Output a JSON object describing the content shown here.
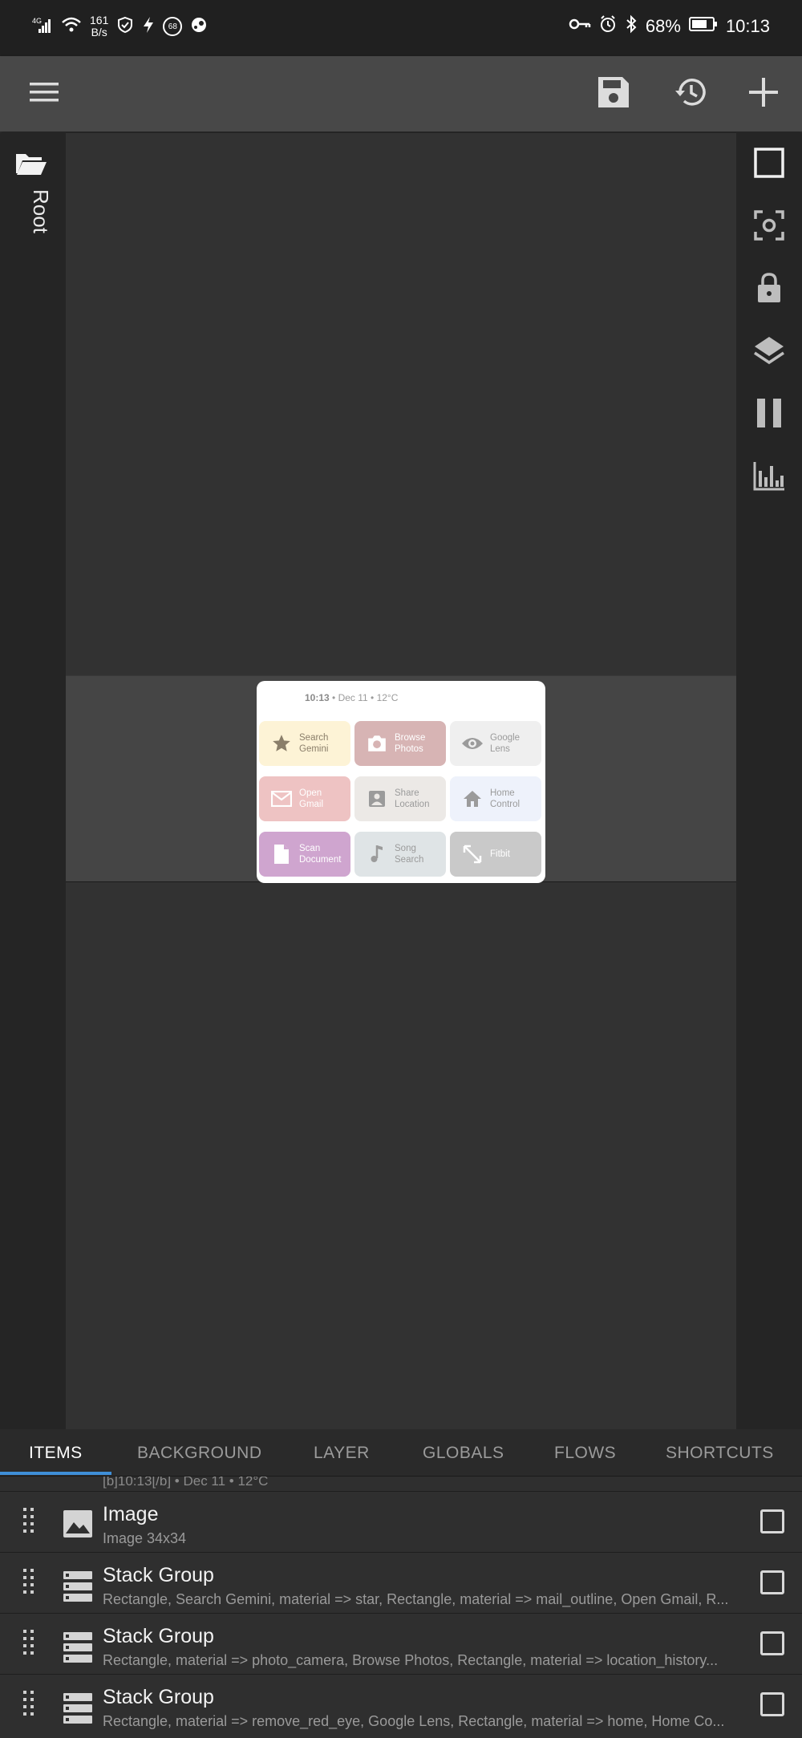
{
  "status_bar": {
    "network": "4G",
    "speed_value": "161",
    "speed_unit": "B/s",
    "notif_badge": "68",
    "battery": "68%",
    "time": "10:13"
  },
  "toolbar": {
    "menu_icon": "menu-icon",
    "save_icon": "save-icon",
    "history_icon": "history-icon",
    "add_icon": "add-icon"
  },
  "left_panel": {
    "root_label": "Root"
  },
  "right_panel": {
    "icons": [
      "square-outline-icon",
      "focus-camera-icon",
      "lock-icon",
      "layers-icon",
      "pause-icon",
      "bar-chart-icon"
    ]
  },
  "widget": {
    "time": "10:13",
    "date_weather": " • Dec 11 • 12°C",
    "tiles": [
      {
        "label1": "Search",
        "label2": "Gemini",
        "icon": "star-icon",
        "bg": "#fdf3d6",
        "fg": "#8a7e6a"
      },
      {
        "label1": "Browse",
        "label2": "Photos",
        "icon": "camera-icon",
        "bg": "#d7b4b4",
        "fg": "#ffffff"
      },
      {
        "label1": "Google",
        "label2": "Lens",
        "icon": "eye-icon",
        "bg": "#efefef",
        "fg": "#9b9b9b"
      },
      {
        "label1": "Open",
        "label2": "Gmail",
        "icon": "mail-icon",
        "bg": "#eec3c3",
        "fg": "#ffffff"
      },
      {
        "label1": "Share",
        "label2": "Location",
        "icon": "location-icon",
        "bg": "#ece9e6",
        "fg": "#9b9b9b"
      },
      {
        "label1": "Home",
        "label2": "Control",
        "icon": "home-icon",
        "bg": "#eef2fb",
        "fg": "#9b9b9b"
      },
      {
        "label1": "Scan",
        "label2": "Document",
        "icon": "document-icon",
        "bg": "#cfa5cf",
        "fg": "#ffffff"
      },
      {
        "label1": "Song",
        "label2": "Search",
        "icon": "music-icon",
        "bg": "#dfe4e6",
        "fg": "#9b9b9b"
      },
      {
        "label1": "Fitbit",
        "label2": "",
        "icon": "expand-icon",
        "bg": "#c9c9c9",
        "fg": "#ffffff"
      }
    ]
  },
  "tabs": [
    "ITEMS",
    "BACKGROUND",
    "LAYER",
    "GLOBALS",
    "FLOWS",
    "SHORTCUTS"
  ],
  "list": {
    "partial_text": "[b]10:13[/b] • Dec 11 • 12°C",
    "rows": [
      {
        "title": "Image",
        "subtitle": "Image 34x34",
        "icon": "image-icon"
      },
      {
        "title": "Stack Group",
        "subtitle": "Rectangle, Search Gemini, material => star, Rectangle, material => mail_outline, Open Gmail, R...",
        "icon": "stack-group-icon"
      },
      {
        "title": "Stack Group",
        "subtitle": "Rectangle, material => photo_camera, Browse Photos, Rectangle, material => location_history...",
        "icon": "stack-group-icon"
      },
      {
        "title": "Stack Group",
        "subtitle": "Rectangle, material => remove_red_eye, Google Lens, Rectangle, material => home, Home Co...",
        "icon": "stack-group-icon"
      }
    ]
  }
}
